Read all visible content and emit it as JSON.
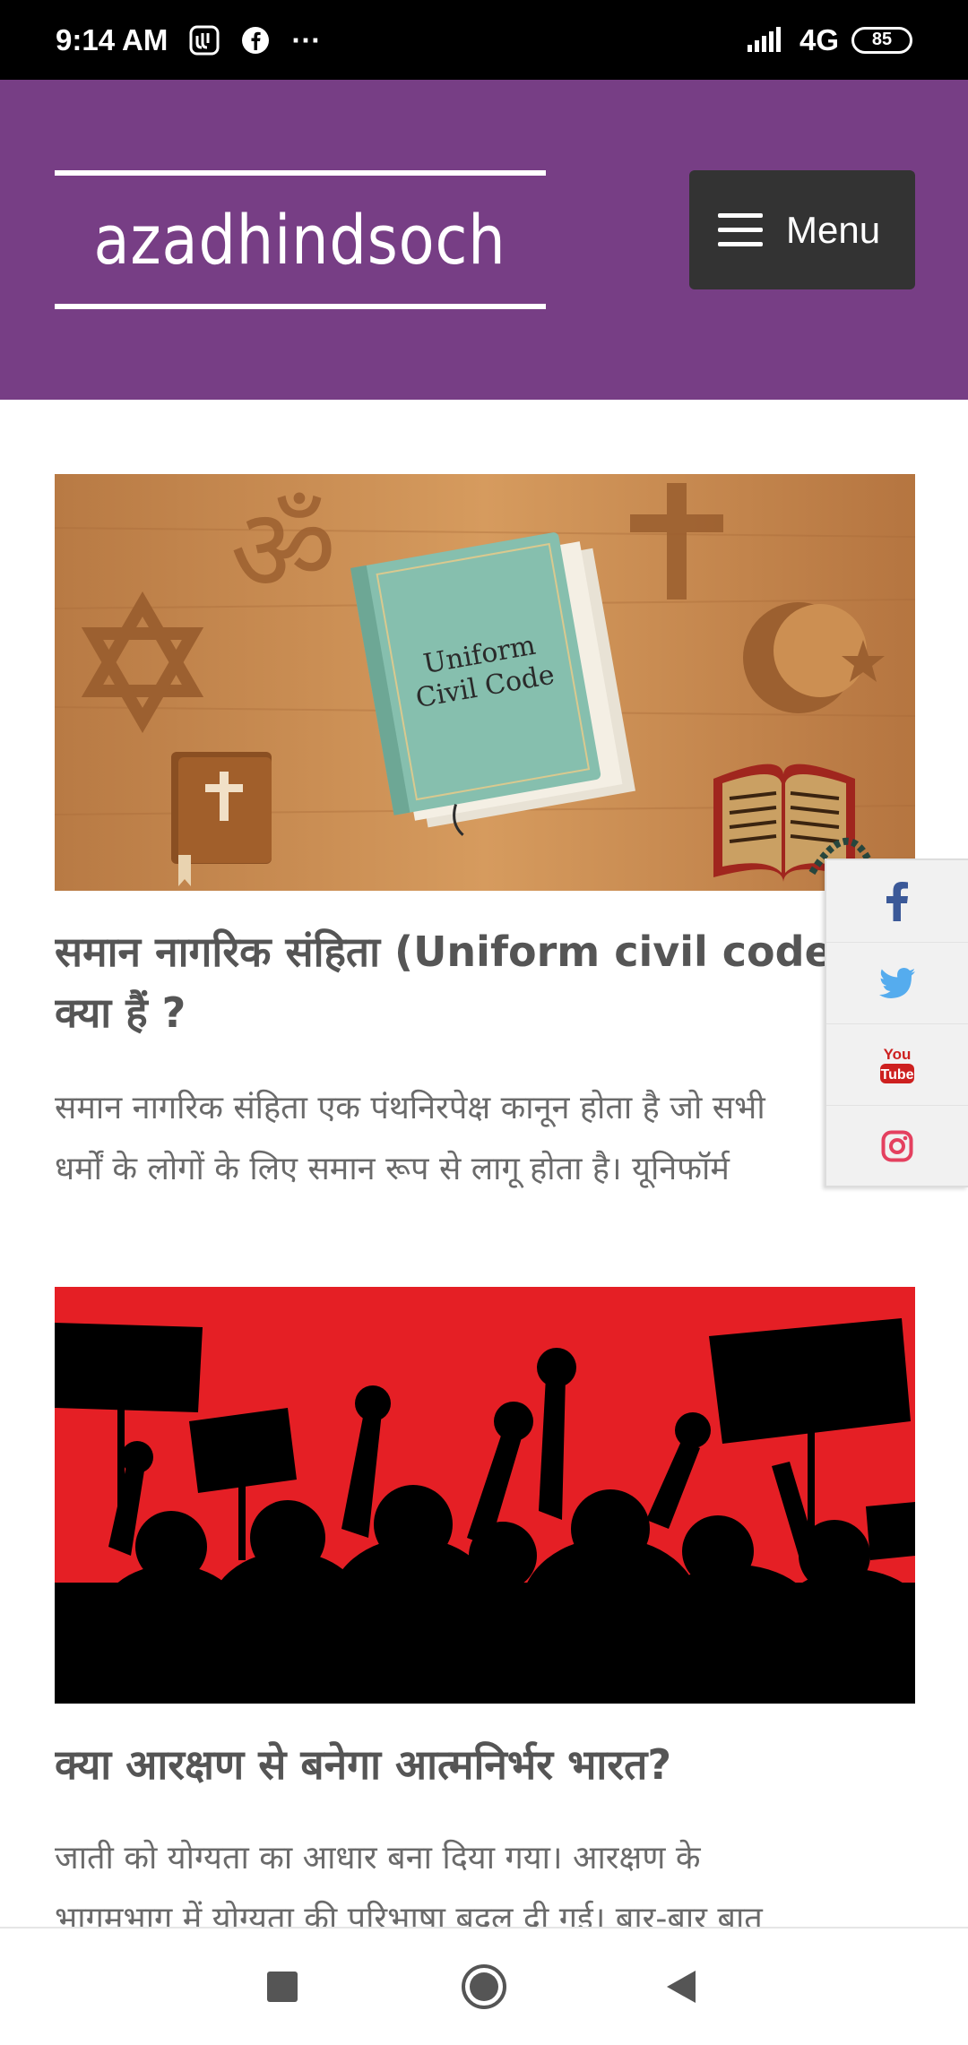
{
  "status_bar": {
    "time": "9:14 AM",
    "network": "4G",
    "battery": "85",
    "more": "···"
  },
  "header": {
    "site_title": "azadhindsoch",
    "menu_label": "Menu"
  },
  "posts": [
    {
      "title_line1": "समान नागरिक संहिता (Uniform civil code)",
      "title_line2": "क्या हैं ?",
      "excerpt_line1": "समान नागरिक संहिता एक पंथनिरपेक्ष कानून होता है जो सभी",
      "excerpt_line2": "धर्मों के लोगों के लिए समान रूप से लागू होता है। यूनिफॉर्म",
      "image_text_line1": "Uniform",
      "image_text_line2": "Civil Code"
    },
    {
      "title_line1": "क्या आरक्षण से बनेगा आत्मनिर्भर भारत?",
      "excerpt_line1": "जाती को योग्यता का आधार बना दिया गया। आरक्षण के",
      "excerpt_line2": "भागमभाग में योग्यता की परिभाषा बदल दी गई। बार-बार बात"
    }
  ],
  "social": {
    "icons": [
      "facebook-icon",
      "twitter-icon",
      "youtube-icon",
      "instagram-icon"
    ],
    "youtube_you": "You",
    "youtube_tube": "Tube"
  },
  "colors": {
    "header_bg": "#773e85",
    "menu_bg": "#333333",
    "facebook": "#3b5998",
    "twitter": "#55acee",
    "youtube": "#cd201f",
    "instagram": "#e4405f"
  }
}
